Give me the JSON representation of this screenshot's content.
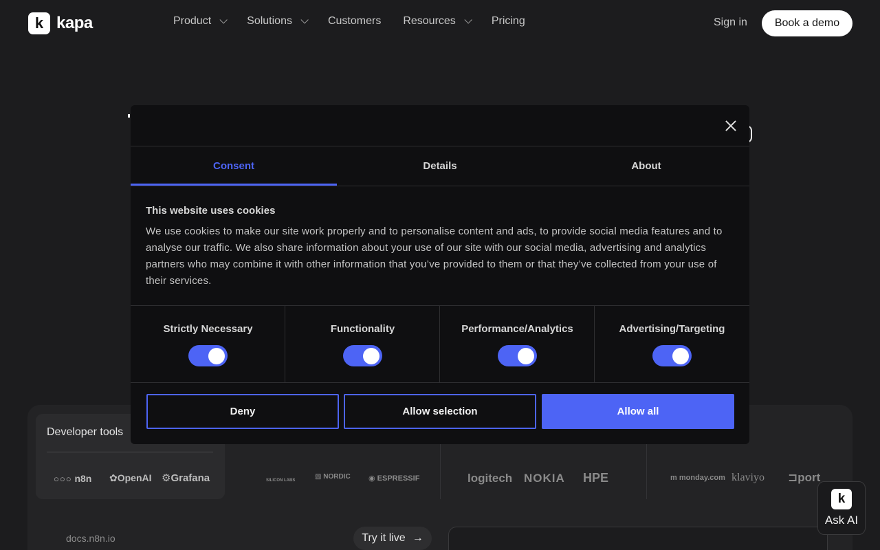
{
  "nav": {
    "logo_text": "kapa",
    "logo_mark": "k",
    "links": [
      {
        "label": "Product",
        "has_dropdown": true
      },
      {
        "label": "Solutions",
        "has_dropdown": true
      },
      {
        "label": "Customers",
        "has_dropdown": false
      },
      {
        "label": "Resources",
        "has_dropdown": true
      },
      {
        "label": "Pricing",
        "has_dropdown": false
      }
    ],
    "signin": "Sign in",
    "demo": "Book a demo"
  },
  "background": {
    "dev_tools_title": "Developer tools",
    "brands": [
      "n8n",
      "OpenAI",
      "Grafana",
      "SILICON LABS",
      "NORDIC",
      "ESPRESSIF",
      "logitech",
      "NOKIA",
      "HPE",
      "monday.com",
      "klaviyo",
      "port"
    ],
    "docs_url": "docs.n8n.io",
    "try_live": "Try it live",
    "ask_ai": "Ask AI",
    "ask_ai_mark": "k"
  },
  "dialog": {
    "tabs": [
      "Consent",
      "Details",
      "About"
    ],
    "active_tab": "Consent",
    "title": "This website uses cookies",
    "body": "We use cookies to make our site work properly and to personalise content and ads, to provide social media features and to analyse our traffic. We also share information about your use of our site with our social media, advertising and analytics partners who may combine it with other information that you’ve provided to them or that they’ve collected from your use of their services.",
    "categories": [
      {
        "label": "Strictly Necessary",
        "enabled": true
      },
      {
        "label": "Functionality",
        "enabled": true
      },
      {
        "label": "Performance/Analytics",
        "enabled": true
      },
      {
        "label": "Advertising/Targeting",
        "enabled": true
      }
    ],
    "buttons": {
      "deny": "Deny",
      "allow_selection": "Allow selection",
      "allow_all": "Allow all"
    }
  },
  "colors": {
    "accent": "#4d64f5",
    "dialog_bg": "#0f0f11",
    "page_bg": "#1c1c1e"
  }
}
